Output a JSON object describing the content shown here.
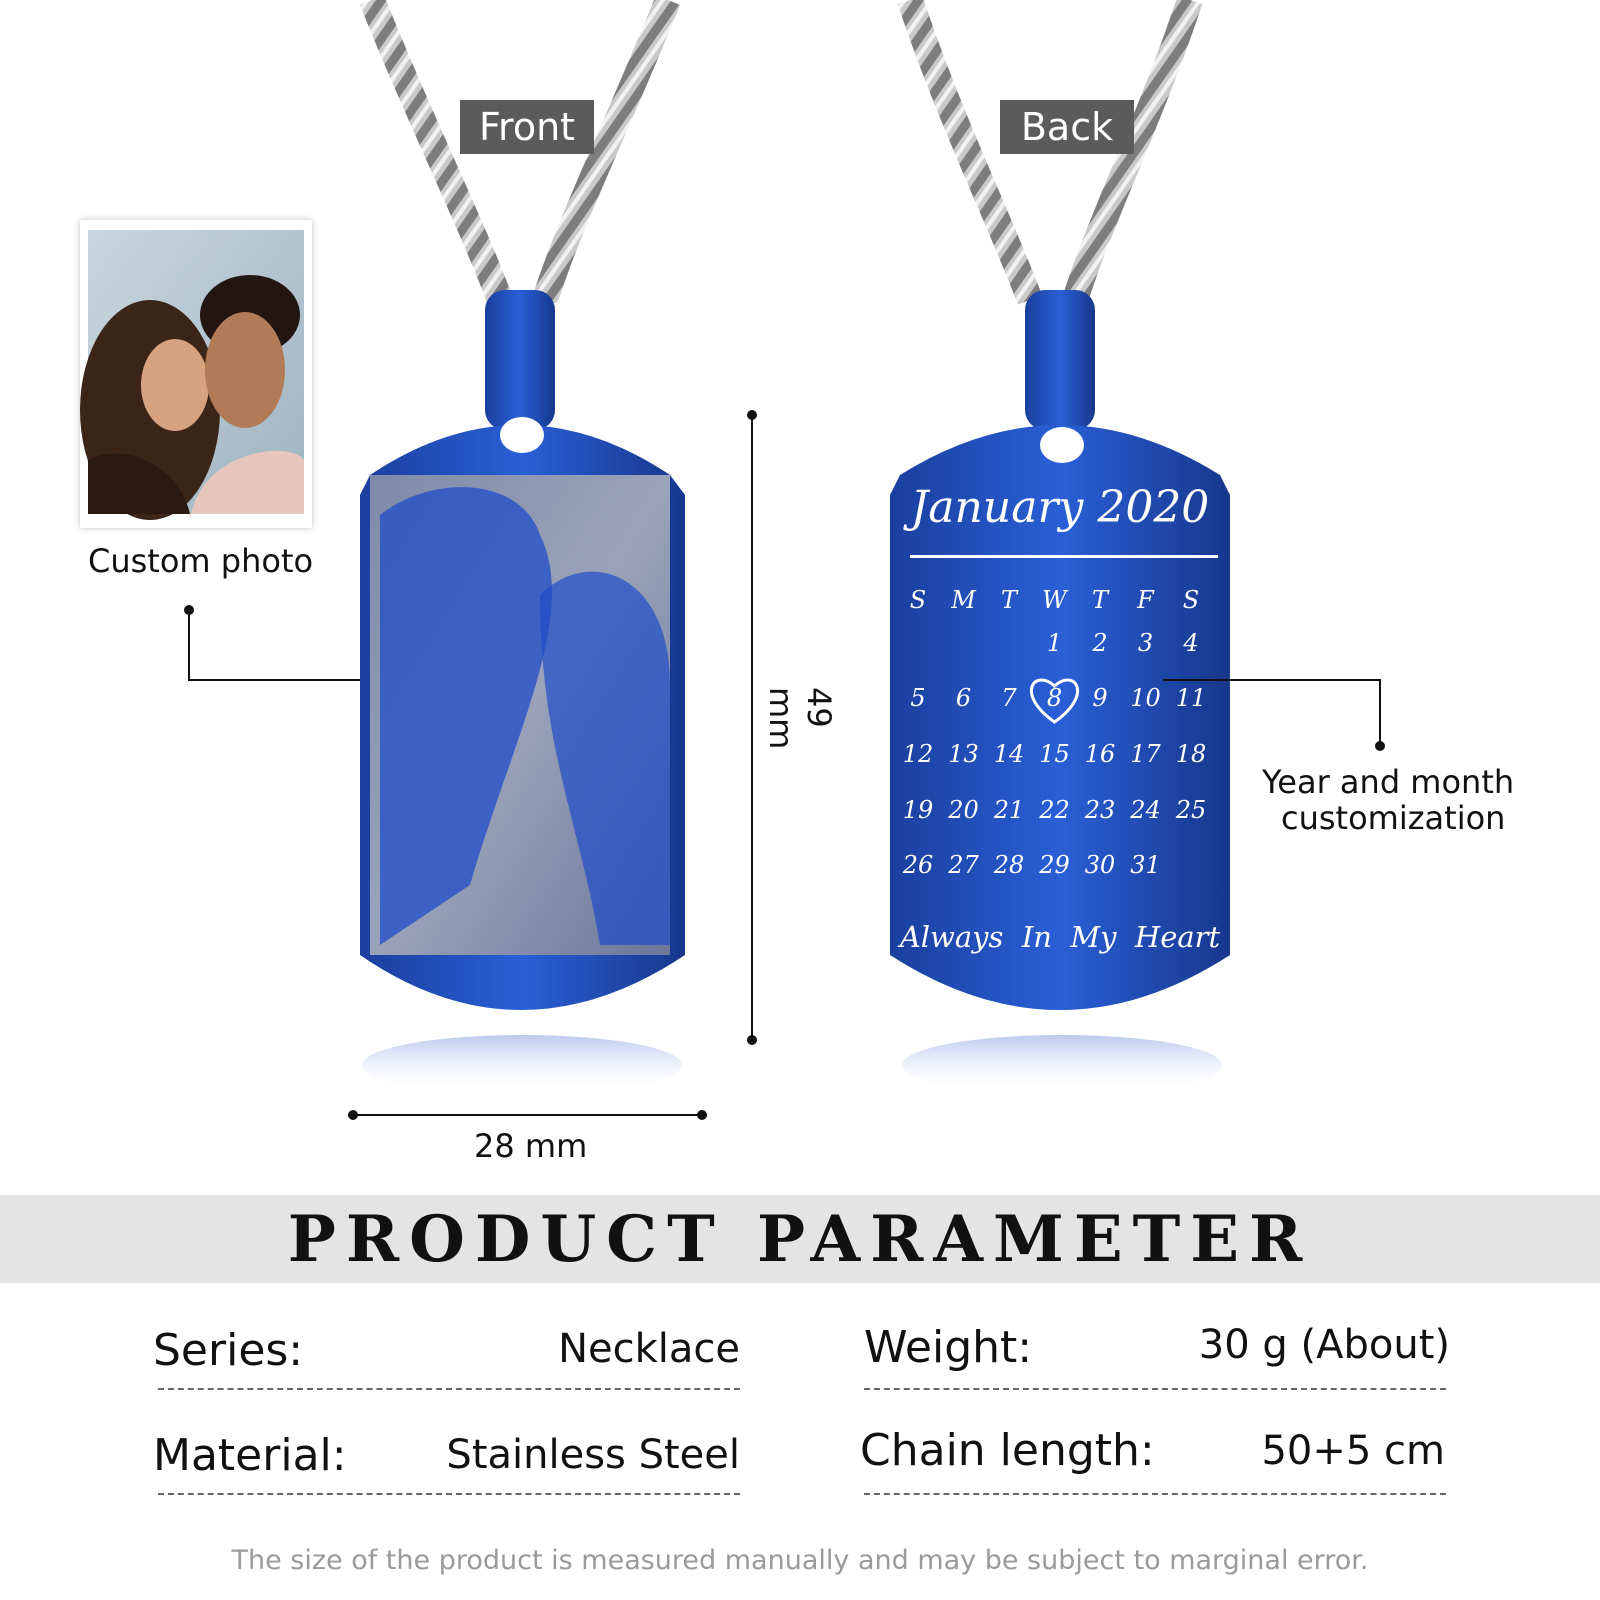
{
  "front_tag": "Front",
  "back_tag": "Back",
  "custom_photo_label": "Custom photo",
  "dimensions": {
    "height": "49 mm",
    "width": "28 mm"
  },
  "customization_label": [
    "Year and month",
    "customization"
  ],
  "calendar": {
    "title": "January 2020",
    "weekdays": [
      "S",
      "M",
      "T",
      "W",
      "T",
      "F",
      "S"
    ],
    "weeks": [
      [
        "",
        "",
        "",
        "1",
        "2",
        "3",
        "4"
      ],
      [
        "5",
        "6",
        "7",
        "8",
        "9",
        "10",
        "11"
      ],
      [
        "12",
        "13",
        "14",
        "15",
        "16",
        "17",
        "18"
      ],
      [
        "19",
        "20",
        "21",
        "22",
        "23",
        "24",
        "25"
      ],
      [
        "26",
        "27",
        "28",
        "29",
        "30",
        "31",
        ""
      ]
    ],
    "highlighted_day": "8",
    "motto": "Always  In  My  Heart"
  },
  "banner_title": "PRODUCT PARAMETER",
  "parameters": {
    "series_key": "Series:",
    "series_value": "Necklace",
    "weight_key": "Weight:",
    "weight_value": "30 g (About)",
    "material_key": "Material:",
    "material_value": "Stainless Steel",
    "chain_key": "Chain length:",
    "chain_value": "50+5 cm"
  },
  "footnote": "The size of the product is measured manually and may be subject to marginal error.",
  "colors": {
    "pendant_blue": "#1e4fbf",
    "tag_gray": "#5b5b5b",
    "banner_gray": "#e4e4e4"
  }
}
